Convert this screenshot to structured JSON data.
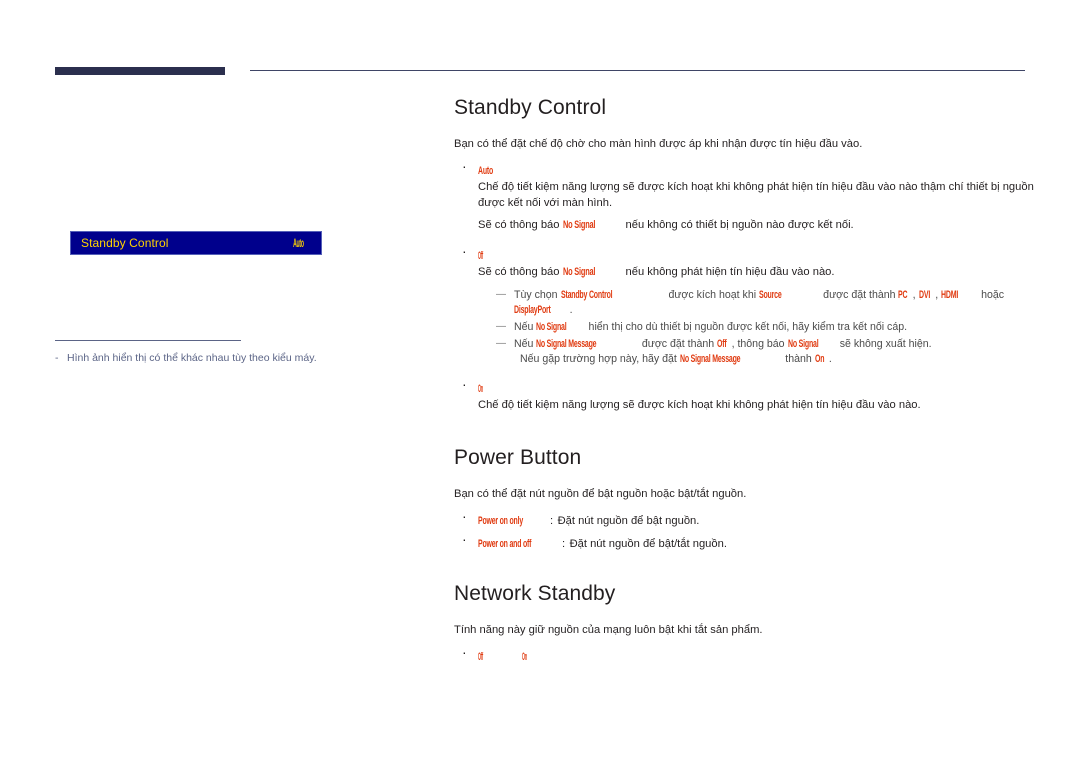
{
  "page": {
    "left_illustration": {
      "osd": {
        "label": "Standby Control",
        "value": "Auto"
      },
      "footnote_dash": "-",
      "footnote": "Hình ảnh hiển thị có thể khác nhau tùy theo kiểu máy."
    },
    "sections": [
      {
        "id": "standby-control",
        "title": "Standby Control",
        "intro": "Bạn có thể đặt chế độ chờ cho màn hình được áp khi nhận được tín hiệu đầu vào.",
        "bullets": [
          {
            "option": "Auto",
            "lines": [
              "Chế độ tiết kiệm năng lượng sẽ được kích hoạt khi không phát hiện tín hiệu đầu vào nào thậm chí thiết bị nguồn được kết nối với màn hình."
            ],
            "notice_prefix": "Sẽ có thông báo",
            "notice_term": "No Signal",
            "notice_suffix": "nếu không có thiết bị nguồn nào được kết nối."
          },
          {
            "option": "Off",
            "notice_prefix": "Sẽ có thông báo",
            "notice_term": "No Signal",
            "notice_suffix": "nếu không phát hiện tín hiệu đầu vào nào.",
            "subnotes": [
              {
                "t1": "Tùy chọn",
                "term1": "Standby Control",
                "t2": "được kích hoạt khi",
                "term2": "Source",
                "t3": "được đặt thành",
                "term3": "PC",
                "sep3": ",",
                "term4": "DVI",
                "sep4": ",",
                "term5": "HDMI",
                "t4": "hoặc",
                "term6": "DisplayPort",
                "t5": "."
              },
              {
                "t1": "Nếu",
                "term1": "No Signal",
                "t2": "hiển thị cho dù thiết bị nguồn được kết nối, hãy kiểm tra kết nối cáp."
              },
              {
                "t1": "Nếu",
                "term1": "No Signal Message",
                "t2": "được đặt thành",
                "term2": "Off",
                "t3": ", thông báo",
                "term3": "No Signal",
                "t4": "sẽ không xuất hiện.",
                "cont_t1": "Nếu gặp trường hợp này, hãy đặt",
                "cont_term1": "No Signal Message",
                "cont_t2": "thành",
                "cont_term2": "On",
                "cont_t3": "."
              }
            ]
          },
          {
            "option": "On",
            "lines": [
              "Chế độ tiết kiệm năng lượng sẽ được kích hoạt khi không phát hiện tín hiệu đầu vào nào."
            ]
          }
        ]
      },
      {
        "id": "power-button",
        "title": "Power Button",
        "intro": "Bạn có thể đặt nút nguồn để bật nguồn hoặc bật/tắt nguồn.",
        "options": [
          {
            "option": "Power on only",
            "colon": ":",
            "desc": "Đặt nút nguồn để bật nguồn."
          },
          {
            "option": "Power on and off",
            "colon": ":",
            "desc": "Đặt nút nguồn để bật/tắt nguồn."
          }
        ]
      },
      {
        "id": "network-standby",
        "title": "Network Standby",
        "intro": "Tính năng này giữ nguồn của mạng luôn bật khi tắt sản phẩm.",
        "toggle_options": [
          "Off",
          "On"
        ]
      }
    ]
  },
  "colors": {
    "accent_red": "#e03a10",
    "osd_background": "#00008c",
    "osd_text": "#ffd400",
    "header_bar": "#2b2f4e",
    "note_text": "#5b6486"
  }
}
